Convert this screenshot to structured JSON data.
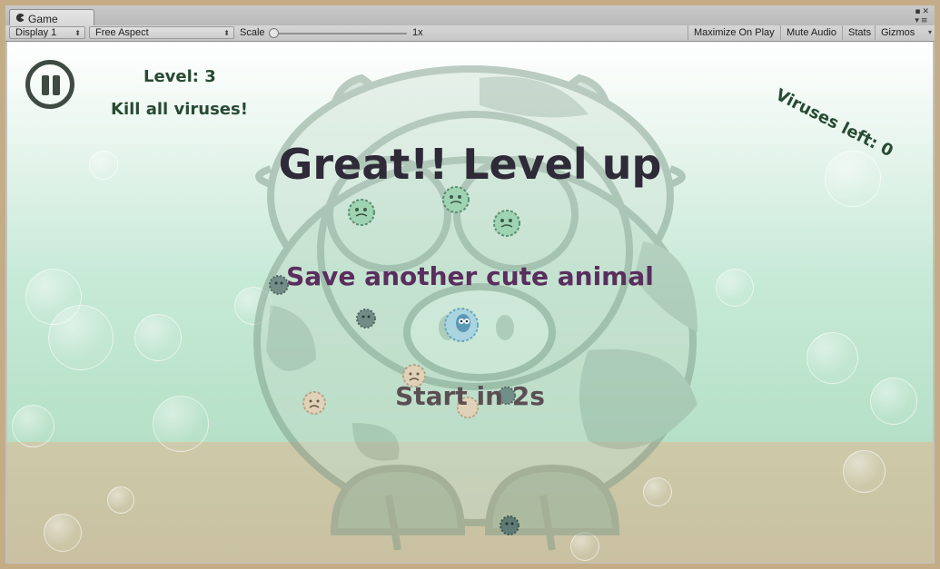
{
  "editor": {
    "tab_title": "Game",
    "display": "Display 1",
    "aspect": "Free Aspect",
    "scale_label": "Scale",
    "scale_value": "1x",
    "scale_level": 0.0,
    "maximize_on_play": "Maximize On Play",
    "mute_audio": "Mute Audio",
    "stats": "Stats",
    "gizmos": "Gizmos"
  },
  "hud": {
    "level": "Level: 3",
    "objective": "Kill all viruses!",
    "viruses_left": "Viruses left: 0"
  },
  "messages": {
    "title": "Great!! Level up",
    "subtitle": "Save another cute animal",
    "countdown": "Start in 2s"
  },
  "colors": {
    "title": "#2e2a38",
    "subtitle": "#5a2e5e",
    "countdown": "#5b4e52",
    "hud_text": "#274a33",
    "sky_top": "#ffffff",
    "sky_bottom": "#b5e0c6",
    "ground": "#ccc9a9"
  }
}
